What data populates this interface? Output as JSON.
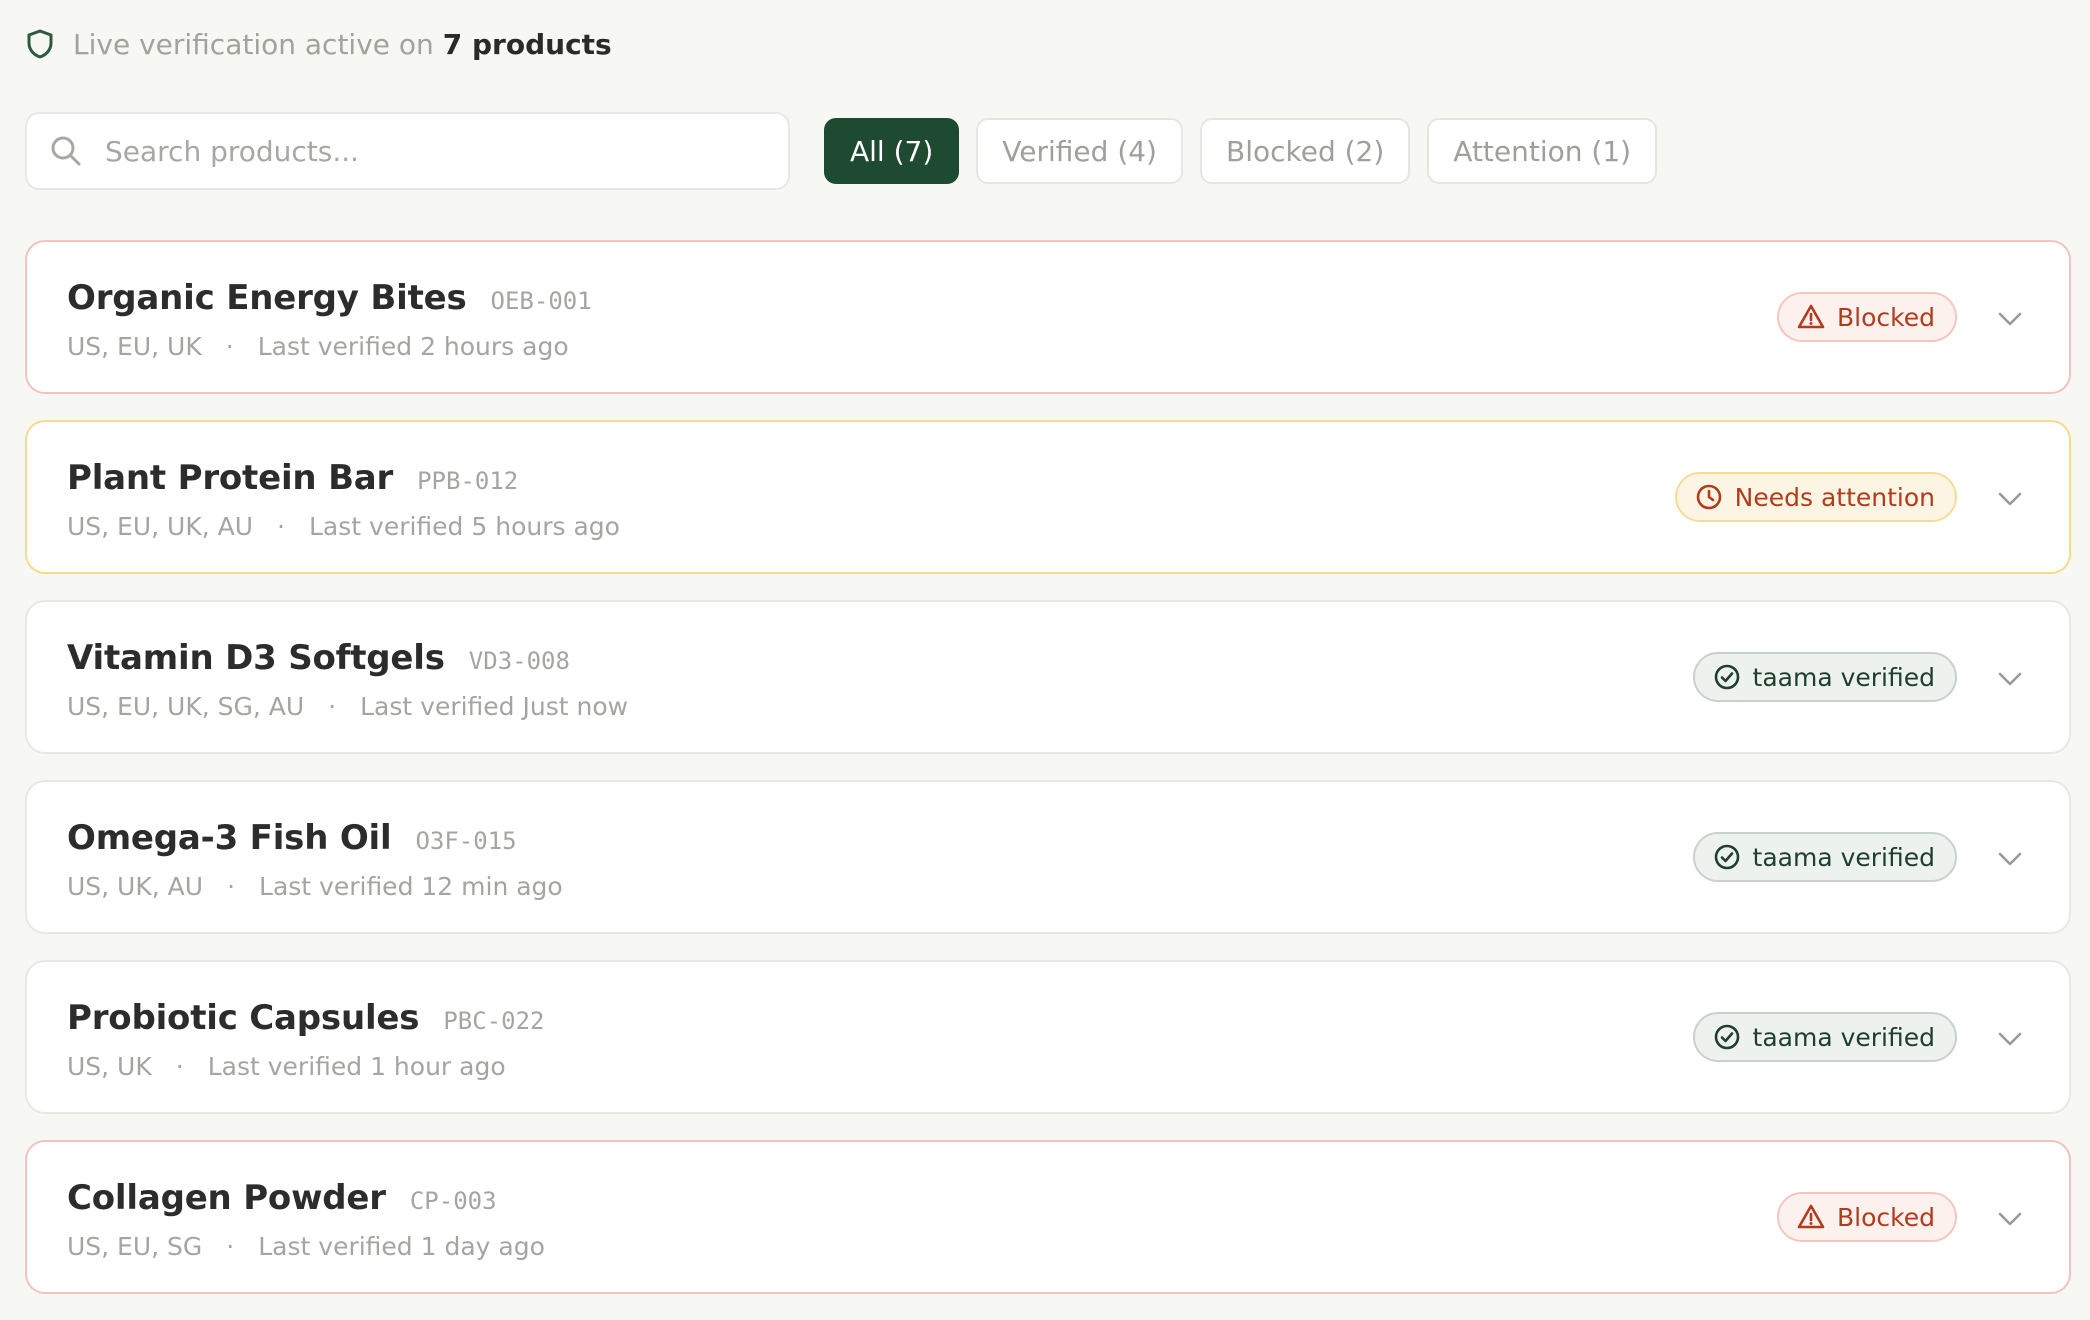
{
  "banner": {
    "text": "Live verification active on",
    "count": "7 products",
    "icon": "shield-icon"
  },
  "search": {
    "placeholder": "Search products...",
    "value": "",
    "icon": "search-icon"
  },
  "filters": [
    {
      "label": "All (7)",
      "active": true
    },
    {
      "label": "Verified (4)",
      "active": false
    },
    {
      "label": "Blocked (2)",
      "active": false
    },
    {
      "label": "Attention (1)",
      "active": false
    }
  ],
  "products": [
    {
      "name": "Organic Energy Bites",
      "sku": "OEB-001",
      "regions": "US, EU, UK",
      "last_verified": "Last verified 2 hours ago",
      "status": "blocked",
      "status_label": "Blocked"
    },
    {
      "name": "Plant Protein Bar",
      "sku": "PPB-012",
      "regions": "US, EU, UK, AU",
      "last_verified": "Last verified 5 hours ago",
      "status": "attention",
      "status_label": "Needs attention"
    },
    {
      "name": "Vitamin D3 Softgels",
      "sku": "VD3-008",
      "regions": "US, EU, UK, SG, AU",
      "last_verified": "Last verified Just now",
      "status": "verified",
      "status_label": "taama verified"
    },
    {
      "name": "Omega-3 Fish Oil",
      "sku": "O3F-015",
      "regions": "US, UK, AU",
      "last_verified": "Last verified 12 min ago",
      "status": "verified",
      "status_label": "taama verified"
    },
    {
      "name": "Probiotic Capsules",
      "sku": "PBC-022",
      "regions": "US, UK",
      "last_verified": "Last verified 1 hour ago",
      "status": "verified",
      "status_label": "taama verified"
    },
    {
      "name": "Collagen Powder",
      "sku": "CP-003",
      "regions": "US, EU, SG",
      "last_verified": "Last verified 1 day ago",
      "status": "blocked",
      "status_label": "Blocked"
    }
  ],
  "separator": "·",
  "colors": {
    "accent": "#1f4a32",
    "blocked": "#b23a1d",
    "attention_border": "#f5dc8a",
    "verified": "#1e3f2b"
  }
}
